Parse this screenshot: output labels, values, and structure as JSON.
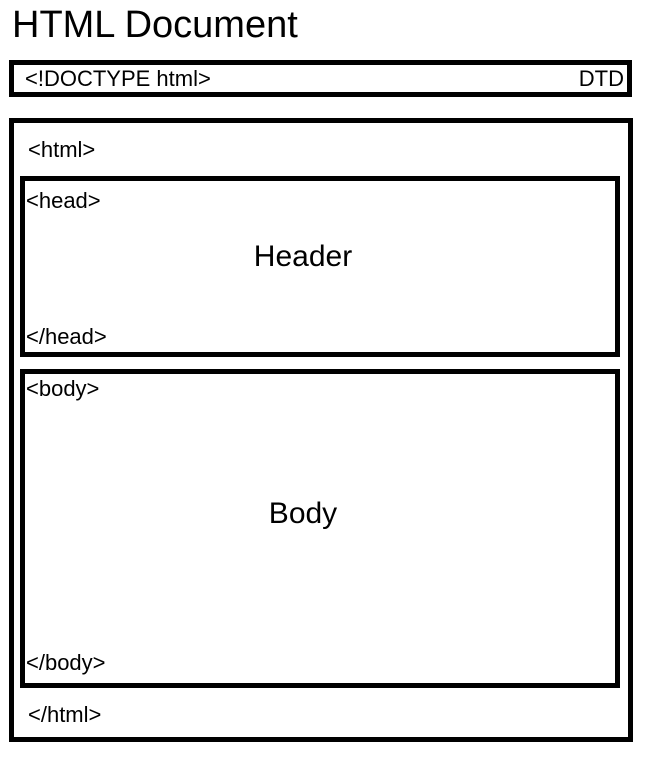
{
  "title": "HTML Document",
  "doctype": {
    "tag": "<!DOCTYPE html>",
    "label": "DTD"
  },
  "html": {
    "open_tag": "<html>",
    "close_tag": "</html>"
  },
  "head": {
    "open_tag": "<head>",
    "label": "Header",
    "close_tag": "</head>"
  },
  "body": {
    "open_tag": "<body>",
    "label": "Body",
    "close_tag": "</body>"
  }
}
